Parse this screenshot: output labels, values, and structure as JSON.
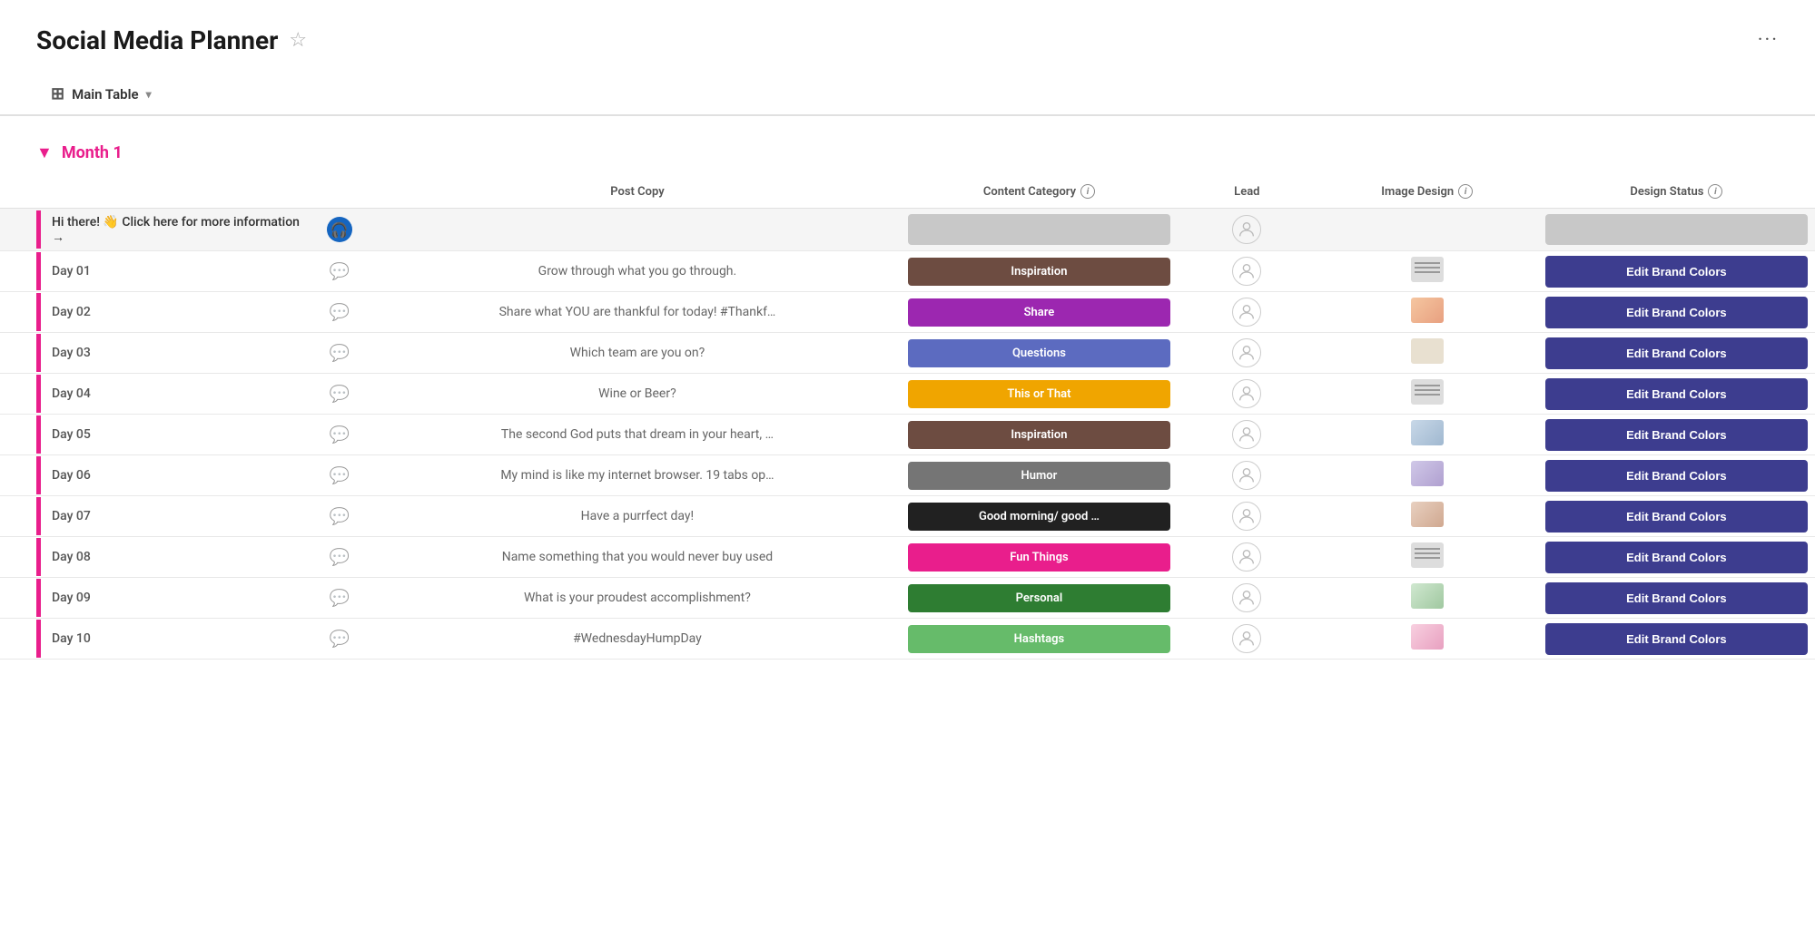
{
  "header": {
    "title": "Social Media Planner",
    "star_label": "☆",
    "more_label": "···"
  },
  "view_tab": {
    "icon": "⊞",
    "label": "Main Table",
    "chevron": "▾"
  },
  "group": {
    "title": "Month 1",
    "collapse_icon": "●"
  },
  "table": {
    "columns": [
      {
        "id": "name",
        "label": ""
      },
      {
        "id": "comment",
        "label": ""
      },
      {
        "id": "post_copy",
        "label": "Post Copy"
      },
      {
        "id": "content_category",
        "label": "Content Category",
        "has_info": true
      },
      {
        "id": "lead",
        "label": "Lead"
      },
      {
        "id": "image_design",
        "label": "Image Design",
        "has_info": true
      },
      {
        "id": "design_status",
        "label": "Design Status",
        "has_info": true
      }
    ],
    "rows": [
      {
        "id": "info",
        "name": "Hi there! 👋 Click here for more information →",
        "has_comment": false,
        "post_copy": "",
        "content_category": "",
        "content_category_class": "cat-empty",
        "lead": true,
        "image_design": "",
        "design_status": "empty"
      },
      {
        "id": "day01",
        "name": "Day 01",
        "has_comment": true,
        "post_copy": "Grow through what you go through.",
        "content_category": "Inspiration",
        "content_category_class": "cat-inspiration",
        "lead": true,
        "image_design": "lines",
        "design_status": "btn"
      },
      {
        "id": "day02",
        "name": "Day 02",
        "has_comment": true,
        "post_copy": "Share what YOU are thankful for today! #Thankf…",
        "content_category": "Share",
        "content_category_class": "cat-share",
        "lead": true,
        "image_design": "photo1",
        "design_status": "btn"
      },
      {
        "id": "day03",
        "name": "Day 03",
        "has_comment": true,
        "post_copy": "Which team are you on?",
        "content_category": "Questions",
        "content_category_class": "cat-questions",
        "lead": true,
        "image_design": "calendar",
        "design_status": "btn"
      },
      {
        "id": "day04",
        "name": "Day 04",
        "has_comment": true,
        "post_copy": "Wine or Beer?",
        "content_category": "This or That",
        "content_category_class": "cat-this-or-that",
        "lead": true,
        "image_design": "lines",
        "design_status": "btn"
      },
      {
        "id": "day05",
        "name": "Day 05",
        "has_comment": true,
        "post_copy": "The second God puts that dream in your heart, …",
        "content_category": "Inspiration",
        "content_category_class": "cat-inspiration",
        "lead": true,
        "image_design": "photo2",
        "design_status": "btn"
      },
      {
        "id": "day06",
        "name": "Day 06",
        "has_comment": true,
        "post_copy": "My mind is like my internet browser. 19 tabs op…",
        "content_category": "Humor",
        "content_category_class": "cat-humor",
        "lead": true,
        "image_design": "photo3",
        "design_status": "btn"
      },
      {
        "id": "day07",
        "name": "Day 07",
        "has_comment": true,
        "post_copy": "Have a purrfect day!",
        "content_category": "Good morning/ good …",
        "content_category_class": "cat-good-morning",
        "lead": true,
        "image_design": "photo4",
        "design_status": "btn"
      },
      {
        "id": "day08",
        "name": "Day 08",
        "has_comment": true,
        "post_copy": "Name something that you would never buy used",
        "content_category": "Fun Things",
        "content_category_class": "cat-fun-things",
        "lead": true,
        "image_design": "lines",
        "design_status": "btn"
      },
      {
        "id": "day09",
        "name": "Day 09",
        "has_comment": true,
        "post_copy": "What is your proudest accomplishment?",
        "content_category": "Personal",
        "content_category_class": "cat-personal",
        "lead": true,
        "image_design": "photo5",
        "design_status": "btn"
      },
      {
        "id": "day10",
        "name": "Day 10",
        "has_comment": true,
        "post_copy": "#WednesdayHumpDay",
        "content_category": "Hashtags",
        "content_category_class": "cat-hashtags",
        "lead": true,
        "image_design": "pink-blur",
        "design_status": "btn"
      }
    ],
    "edit_brand_label": "Edit Brand Colors"
  }
}
